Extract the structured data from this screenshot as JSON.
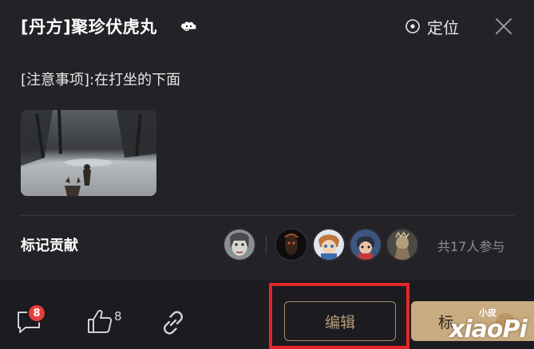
{
  "header": {
    "title": "[丹方]聚珍伏虎丸",
    "locate_label": "定位"
  },
  "note": "[注意事项]:在打坐的下面",
  "contributors": {
    "label": "标记贡献",
    "count_text": "共17人参与"
  },
  "footer": {
    "comment_badge": "8",
    "like_count": "8",
    "edit_label": "编辑",
    "mark_label": "标"
  },
  "watermark": {
    "small": "小皮",
    "large": "xiaoPi"
  },
  "colors": {
    "background": "#232227",
    "footer": "#1c1b20",
    "accent_gold": "#c8ab80",
    "edit_border": "#a38d6b",
    "badge_red": "#e83d3d",
    "highlight_red": "#e3262a"
  },
  "icons": [
    "cloud-icon",
    "locate-pin-icon",
    "close-icon",
    "comment-icon",
    "thumbs-up-icon",
    "link-icon"
  ]
}
